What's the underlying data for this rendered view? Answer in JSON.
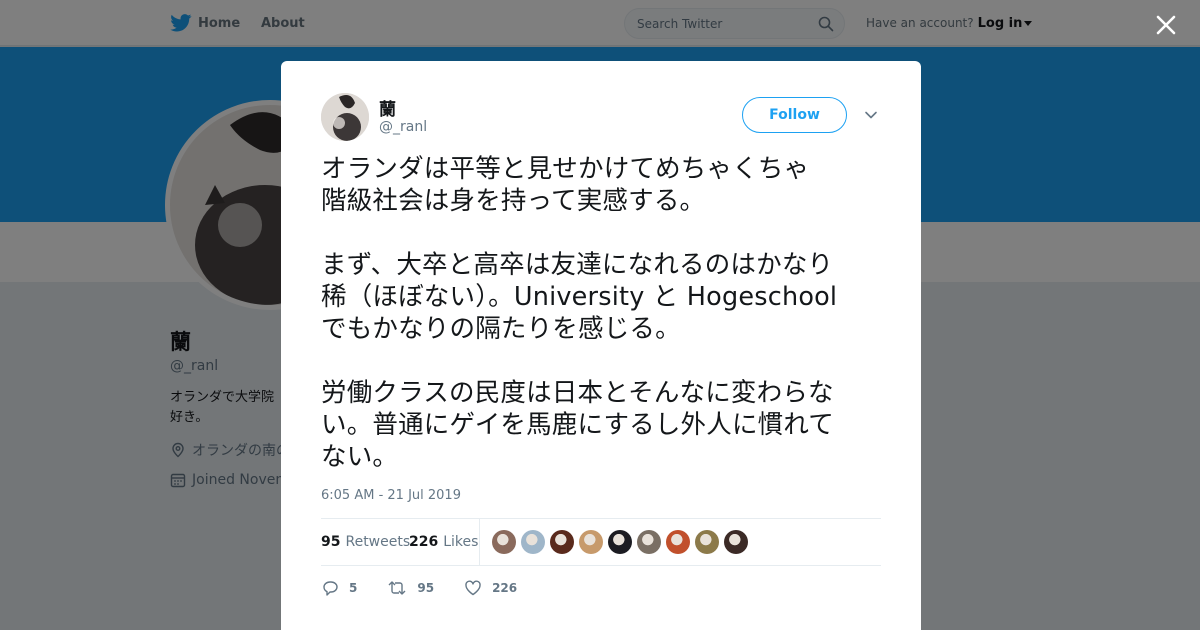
{
  "nav": {
    "home": "Home",
    "about": "About"
  },
  "search": {
    "placeholder": "Search Twitter"
  },
  "account": {
    "prompt": "Have an account?",
    "login": "Log in"
  },
  "profile": {
    "name": "蘭",
    "handle": "@_ranl",
    "bio": "オランダで大学院 好き。",
    "location": "オランダの南の",
    "joined": "Joined Novem"
  },
  "tweet": {
    "name": "蘭",
    "handle": "@_ranl",
    "follow_label": "Follow",
    "paragraphs": [
      [
        "オランダは平等と見せかけてめちゃくちゃ",
        "階級社会は身を持って実感する。"
      ],
      [
        "まず、大卒と高卒は友達になれるのはかなり",
        "稀（ほぼない）。University と Hogeschool",
        "でもかなりの隔たりを感じる。"
      ],
      [
        "労働クラスの民度は日本とそんなに変わらな",
        "い。普通にゲイを馬鹿にするし外人に慣れて",
        "ない。"
      ]
    ],
    "timestamp": "6:05 AM - 21 Jul 2019",
    "retweets": "95",
    "retweets_label": "Retweets",
    "likes": "226",
    "likes_label": "Likes",
    "replies_count": "5",
    "retweet_count": "95",
    "like_count": "226"
  },
  "liker_colors": [
    "#8a6a5c",
    "#9fb6c9",
    "#5a2a1c",
    "#c79a6b",
    "#1c1c22",
    "#7a6f64",
    "#c1502c",
    "#8c7a4a",
    "#3b2a26"
  ],
  "colors": {
    "accent": "#1da1f2",
    "text": "#14171a",
    "muted": "#657786"
  }
}
